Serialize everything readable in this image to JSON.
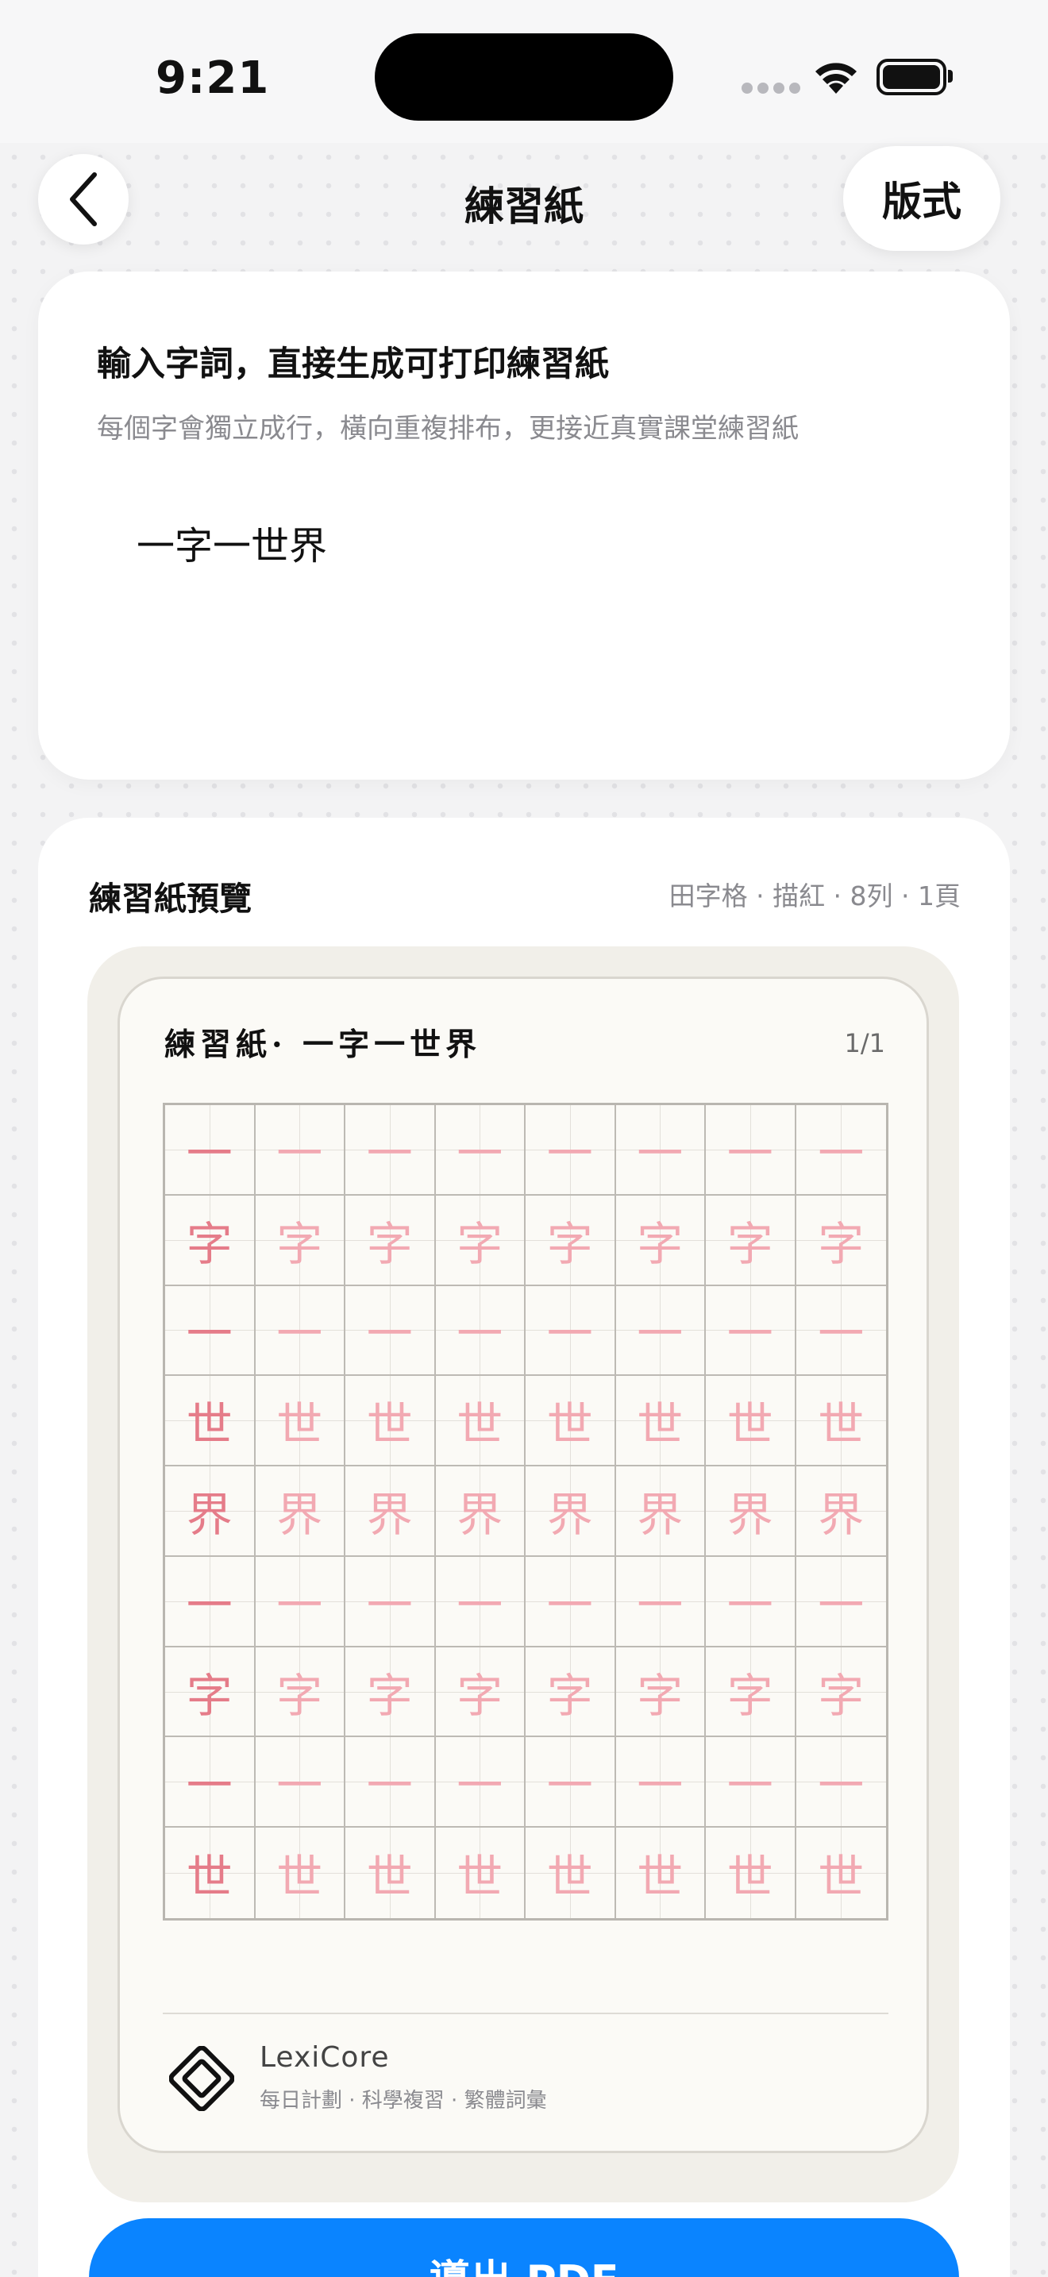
{
  "status": {
    "time": "9:21"
  },
  "nav": {
    "title": "練習紙",
    "format_label": "版式"
  },
  "input": {
    "heading": "輸入字詞，直接生成可打印練習紙",
    "subtitle": "每個字會獨立成行，橫向重複排布，更接近真實課堂練習紙",
    "value": "一字一世界"
  },
  "preview": {
    "title": "練習紙預覽",
    "meta": "田字格 · 描紅 · 8列 · 1頁",
    "paper_title": "練習紙·  一字一世界",
    "page_indicator": "1/1",
    "columns": 8,
    "rows": [
      "一",
      "字",
      "一",
      "世",
      "界",
      "一",
      "字",
      "一",
      "世"
    ]
  },
  "brand": {
    "name": "LexiCore",
    "tagline": "每日計劃 · 科學複習 · 繁體詞彙"
  },
  "export_label": "導出 PDF"
}
